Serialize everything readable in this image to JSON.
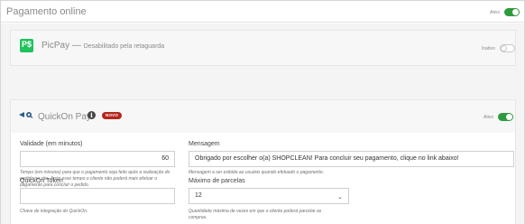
{
  "header": {
    "title": "Pagamento online",
    "toggle_label": "Ativo",
    "toggle_on": true
  },
  "picpay": {
    "logo_text": "P$",
    "title": "PicPay",
    "separator": " — ",
    "subtitle": "Desabilitado pela retaguarda",
    "toggle_label": "Inativo",
    "toggle_on": false
  },
  "quickon": {
    "title": "QuickOn Pay",
    "info": "i",
    "badge": "NOVO",
    "toggle_label": "Ativo",
    "toggle_on": true,
    "validade": {
      "label": "Validade (em minutos)",
      "value": "60",
      "help": "Tempo (em minutos) para que o pagamento seja feito após a realização do pedido no site. Após esse tempo o cliente não poderá mais efetuar o pagamento para concluir o pedido."
    },
    "mensagem": {
      "label": "Mensagem",
      "value": "Obrigado por escolher o(a) SHOPCLEAN! Para concluir seu pagamento, clique no link abaixo!",
      "help": "Mensagem a ser exibida ao usuário quando efetuado o pagamento."
    },
    "token": {
      "label": "QuickOn Token",
      "value": "",
      "help": "Chave de integração do QuickOn."
    },
    "parcelas": {
      "label": "Máximo de parcelas",
      "value": "12",
      "help": "Quantidade máxima de vezes em que o cliente poderá parcelar as compras."
    }
  },
  "colors": {
    "toggle_on": "#2e9a3e",
    "badge": "#b3261e",
    "picpay_green": "#21c25e"
  }
}
